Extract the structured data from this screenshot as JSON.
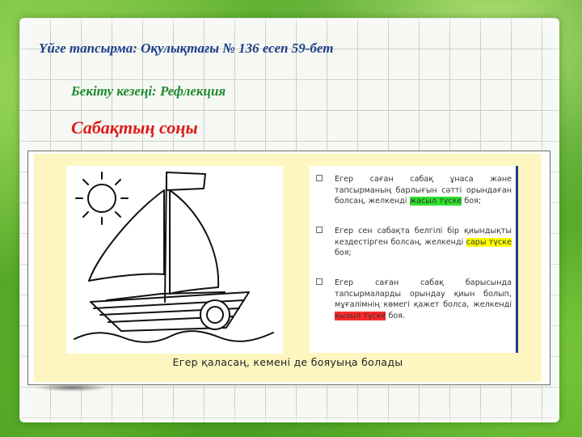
{
  "header": {
    "homework": "Үйге тапсырма: Оқулықтағы № 136 есеп 59-бет",
    "stage": "Бекіту кезеңі:  Рефлекция",
    "lesson_end": "Сабақтың соңы"
  },
  "reflection": {
    "items": [
      {
        "before": "Егер саған сабақ ұнаса және тапсырманың барлығын сәтті орындаған болсаң, желкенді ",
        "highlight": "жасыл түске",
        "after": "  боя;",
        "highlight_color": "#2ee32e"
      },
      {
        "before": "Егер сен сабақта белгілі бір қиындықты кездестірген болсаң, желкенді ",
        "highlight": "сары түске",
        "after": " боя;",
        "highlight_color": "#ffff00"
      },
      {
        "before": "Егер саған сабақ барысында тапсырмаларды орындау қиын болып, мұғалімнің көмегі қажет болса, желкенді ",
        "highlight": "қызыл түске",
        "after": " боя.",
        "highlight_color": "#ff2a2a"
      }
    ],
    "caption": "Егер қаласаң, кемені де бояуыңа болады"
  },
  "icons": [
    "sun-icon",
    "sailboat-icon",
    "lifebuoy-icon",
    "waves-icon"
  ]
}
